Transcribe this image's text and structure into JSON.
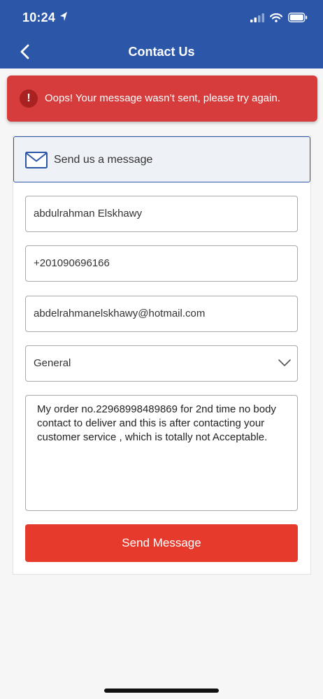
{
  "status_bar": {
    "time": "10:24"
  },
  "nav": {
    "title": "Contact Us"
  },
  "error_banner": {
    "icon": "!",
    "message": "Oops! Your message wasn’t sent, please try again.",
    "color": "#d63c3c"
  },
  "form": {
    "title": "Send us a message",
    "name": "abdulrahman Elskhawy",
    "phone": "+201090696166",
    "email": "abdelrahmanelskhawy@hotmail.com",
    "subject": "General",
    "message": "My order no.22968998489869 for 2nd time no body contact to deliver and this is after contacting your customer service , which is totally not Acceptable.",
    "submit_label": "Send Message"
  },
  "colors": {
    "header": "#2c57a8",
    "submit_button": "#e53a2c"
  },
  "icons": {
    "back": "chevron-left-icon",
    "location": "location-arrow-icon",
    "signal": "cellular-signal-icon",
    "wifi": "wifi-icon",
    "battery": "battery-icon",
    "error": "exclamation-icon",
    "envelope": "envelope-icon",
    "dropdown": "chevron-down-icon"
  }
}
